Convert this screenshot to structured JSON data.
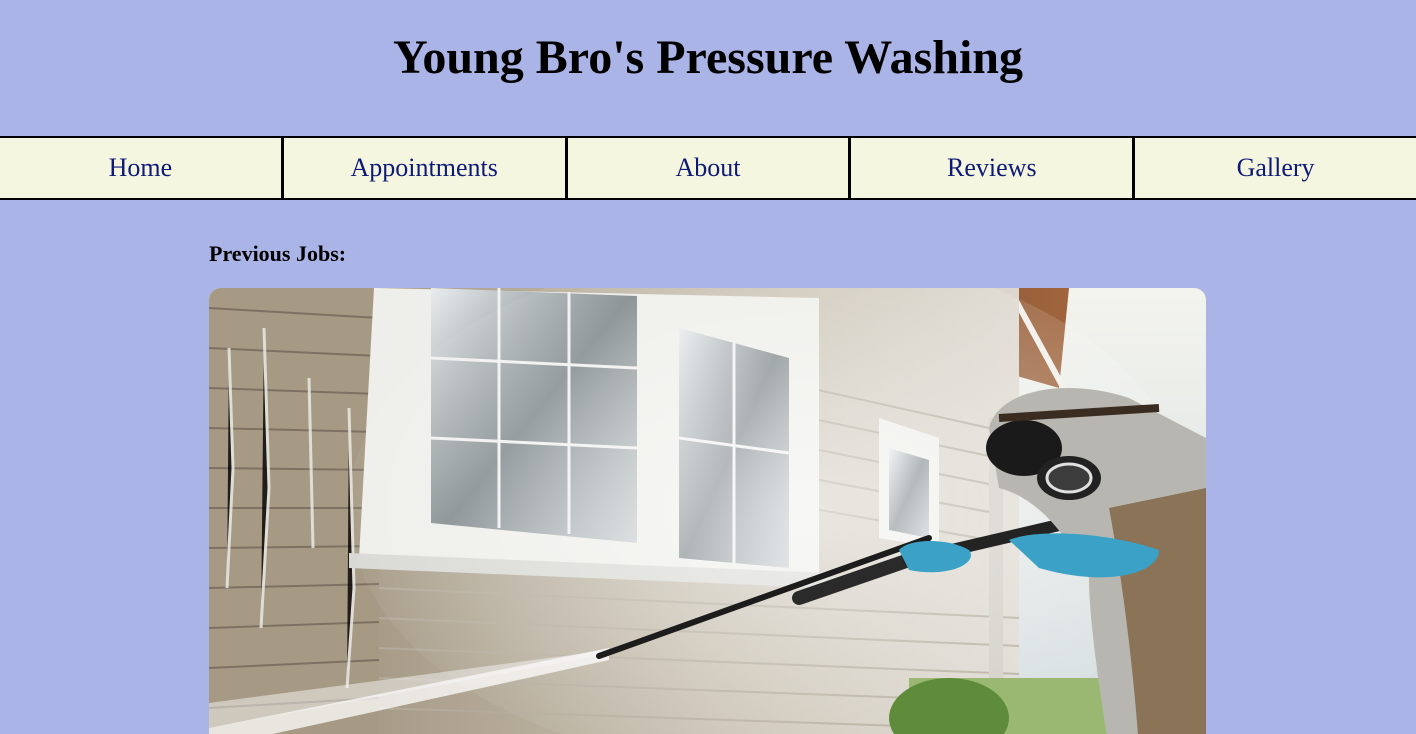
{
  "header": {
    "title": "Young Bro's Pressure Washing"
  },
  "nav": {
    "items": [
      {
        "label": "Home"
      },
      {
        "label": "Appointments"
      },
      {
        "label": "About"
      },
      {
        "label": "Reviews"
      },
      {
        "label": "Gallery"
      }
    ]
  },
  "main": {
    "section_title": "Previous Jobs:"
  },
  "colors": {
    "page_background": "#aab4e6",
    "nav_background": "#f5f6df",
    "nav_text": "#0e1a78"
  }
}
